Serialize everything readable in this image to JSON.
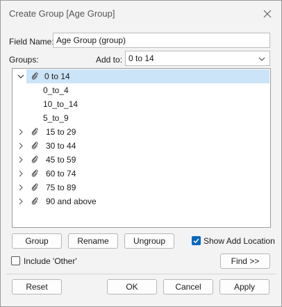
{
  "window": {
    "title": "Create Group [Age Group]"
  },
  "field_name": {
    "label": "Field Name:",
    "value": "Age Group (group)"
  },
  "groups_label": "Groups:",
  "add_to": {
    "label": "Add to:",
    "value": "0 to 14"
  },
  "tree": {
    "groups": [
      {
        "label": "0 to 14",
        "expanded": true,
        "selected": true,
        "members": [
          "0_to_4",
          "10_to_14",
          "5_to_9"
        ]
      },
      {
        "label": "15 to 29"
      },
      {
        "label": "30 to 44"
      },
      {
        "label": "45 to 59"
      },
      {
        "label": "60 to 74"
      },
      {
        "label": "75 to 89"
      },
      {
        "label": "90 and above"
      }
    ]
  },
  "buttons": {
    "group": "Group",
    "rename": "Rename",
    "ungroup": "Ungroup",
    "find": "Find >>",
    "reset": "Reset",
    "ok": "OK",
    "cancel": "Cancel",
    "apply": "Apply"
  },
  "checkboxes": {
    "show_add_location": {
      "label": "Show Add Location",
      "checked": true
    },
    "include_other": {
      "label": "Include 'Other'",
      "checked": false
    }
  },
  "colors": {
    "accent": "#0067c0",
    "selection": "#cce4f7"
  }
}
